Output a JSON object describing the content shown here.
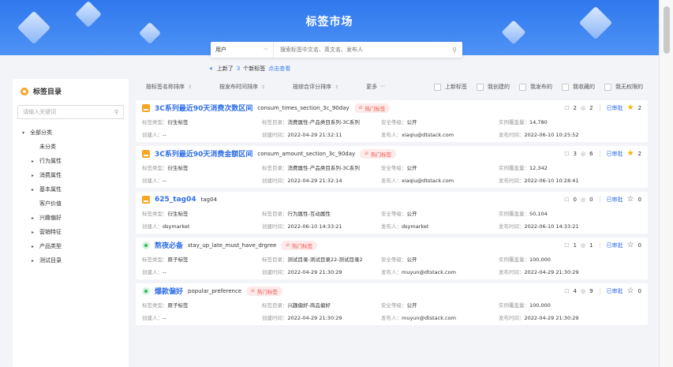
{
  "banner": {
    "title": "标签市场"
  },
  "search": {
    "scope": "用户",
    "placeholder": "搜索标签中文名、英文名、发布人"
  },
  "notice": {
    "prefix": "上新了",
    "count": "3",
    "suffix": "个新标签",
    "link": "点击查看"
  },
  "sidebar": {
    "title": "标签目录",
    "search_placeholder": "请输入关键词",
    "items": [
      {
        "label": "全部分类",
        "level": 0,
        "arrow": "▾"
      },
      {
        "label": "未分类",
        "level": 2,
        "arrow": ""
      },
      {
        "label": "行为属性",
        "level": 1,
        "arrow": "▸"
      },
      {
        "label": "消费属性",
        "level": 1,
        "arrow": "▸"
      },
      {
        "label": "基本属性",
        "level": 1,
        "arrow": "▸"
      },
      {
        "label": "客户价值",
        "level": 2,
        "arrow": ""
      },
      {
        "label": "兴趣偏好",
        "level": 1,
        "arrow": "▸"
      },
      {
        "label": "营销特征",
        "level": 1,
        "arrow": "▸"
      },
      {
        "label": "产品类型",
        "level": 1,
        "arrow": "▸"
      },
      {
        "label": "测试目录",
        "level": 1,
        "arrow": "▸"
      }
    ]
  },
  "filters": {
    "sorts": [
      "按标签名称排序",
      "按发布时间排序",
      "按综合评分排序",
      "更多"
    ],
    "checks": [
      "上新标签",
      "我创建的",
      "我发布的",
      "我收藏的",
      "我无权限的"
    ]
  },
  "labels": {
    "type": "标签类型：",
    "catalog": "标签目录：",
    "security": "安全等级：",
    "coverage": "实例覆盖量：",
    "creator": "创建人：",
    "created": "创建时间：",
    "publisher": "发布人：",
    "published": "发布时间：",
    "hot": "热门标签",
    "audit": "已审批"
  },
  "cards": [
    {
      "icon": "orange",
      "name": "3C系列最近90天消费次数区间",
      "code": "consum_times_section_3c_90day",
      "hot": true,
      "views": "2",
      "watch": "2",
      "starred": true,
      "stars": "2",
      "type": "衍生标签",
      "catalog": "消费属性-产品类目系列-3C系列",
      "security": "公开",
      "coverage": "14,780",
      "creator": "--",
      "created": "2022-04-29 21:32:11",
      "publisher": "xiaqiu@dtstack.com",
      "published": "2022-06-10 10:25:52"
    },
    {
      "icon": "orange",
      "name": "3C系列最近90天消费金额区间",
      "code": "consum_amount_section_3c_90day",
      "hot": true,
      "views": "3",
      "watch": "6",
      "starred": true,
      "stars": "2",
      "type": "衍生标签",
      "catalog": "消费属性-产品类目系列-3C系列",
      "security": "公开",
      "coverage": "12,342",
      "creator": "--",
      "created": "2022-04-29 21:32:14",
      "publisher": "xiaqiu@dtstack.com",
      "published": "2022-06-10 10:28:41"
    },
    {
      "icon": "orange",
      "name": "625_tag04",
      "code": "tag04",
      "hot": false,
      "views": "0",
      "watch": "0",
      "starred": false,
      "stars": "0",
      "type": "衍生标签",
      "catalog": "行为属性-互动属性",
      "security": "公开",
      "coverage": "50,104",
      "creator": "dsymarket",
      "created": "2022-06-10 14:33:21",
      "publisher": "dsymarket",
      "published": "2022-06-10 14:33:21"
    },
    {
      "icon": "green",
      "name": "熬夜必备",
      "code": "stay_up_late_must_have_drgree",
      "hot": true,
      "views": "1",
      "watch": "1",
      "starred": false,
      "stars": "0",
      "type": "原子标签",
      "catalog": "测试目录-测试目录22-测试目录2",
      "security": "公开",
      "coverage": "100,000",
      "creator": "--",
      "created": "2022-04-29 21:30:29",
      "publisher": "muyun@dtstack.com",
      "published": "2022-04-29 21:30:29"
    },
    {
      "icon": "green",
      "name": "爆款偏好",
      "code": "popular_preference",
      "hot": true,
      "views": "4",
      "watch": "9",
      "starred": false,
      "stars": "0",
      "type": "原子标签",
      "catalog": "兴趣偏好-商品偏好",
      "security": "公开",
      "coverage": "100,000",
      "creator": "--",
      "created": "2022-04-29 21:30:29",
      "publisher": "muyun@dtstack.com",
      "published": "2022-04-29 21:30:29"
    }
  ]
}
